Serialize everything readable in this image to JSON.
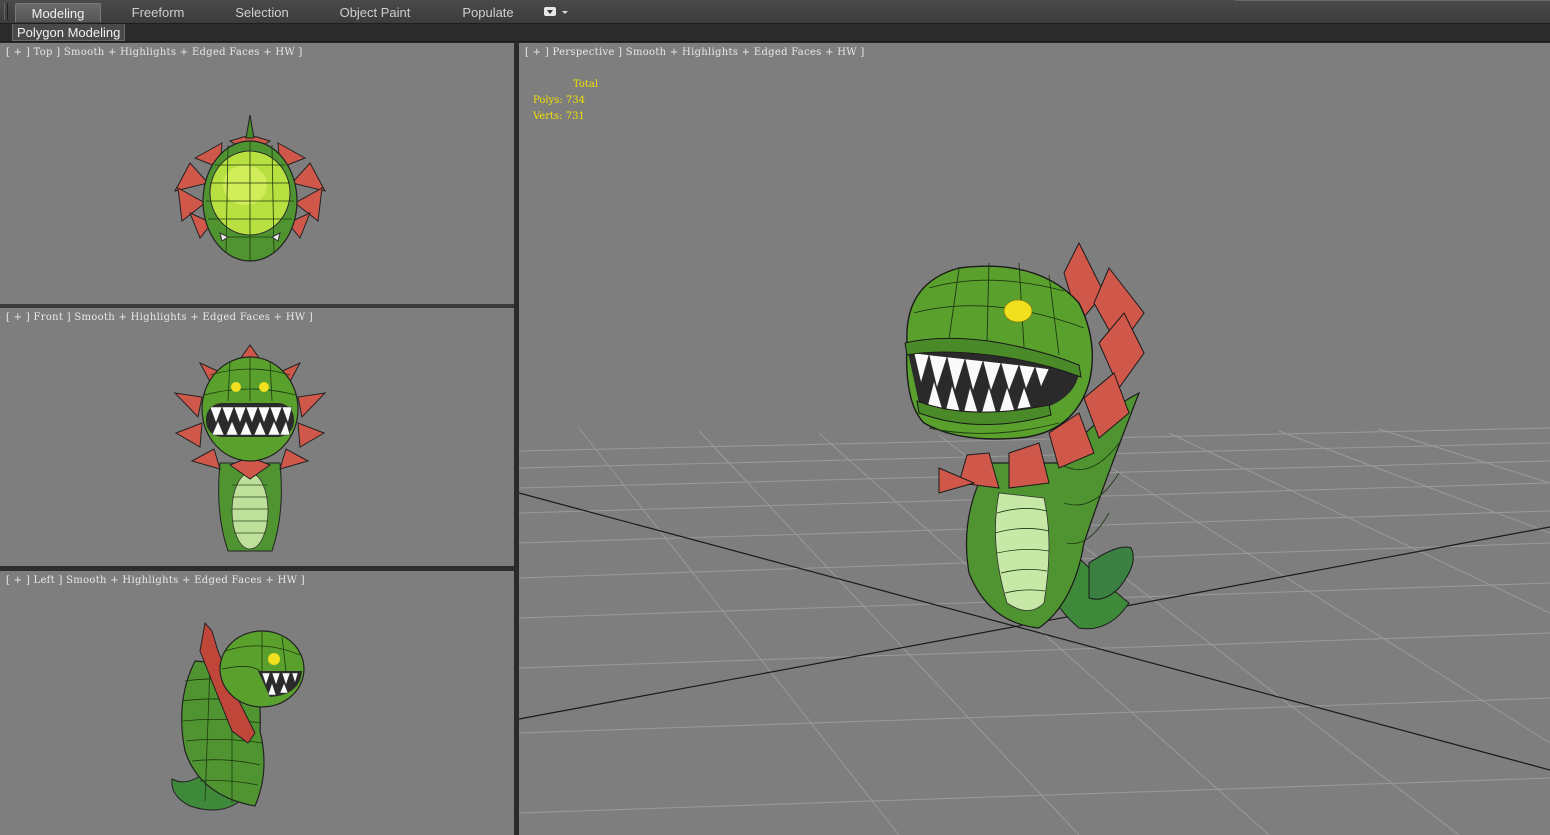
{
  "ribbon": {
    "tabs": [
      {
        "label": "Modeling",
        "active": true
      },
      {
        "label": "Freeform",
        "active": false
      },
      {
        "label": "Selection",
        "active": false
      },
      {
        "label": "Object Paint",
        "active": false
      },
      {
        "label": "Populate",
        "active": false
      }
    ],
    "dropdown_icon": "ribbon-options-dropdown-icon",
    "panel_label": "Polygon Modeling"
  },
  "viewports": {
    "top": {
      "label": "[ + ] Top ] Smooth + Highlights + Edged Faces + HW ]"
    },
    "front": {
      "label": "[ + ] Front ] Smooth + Highlights + Edged Faces + HW ]"
    },
    "left": {
      "label": "[ + ] Left ] Smooth + Highlights + Edged Faces + HW ]"
    },
    "perspective": {
      "label": "[ + ] Perspective ] Smooth + Highlights + Edged Faces + HW ]",
      "stats": {
        "total_label": "Total",
        "polys": "Polys: 734",
        "verts": "Verts: 731"
      }
    }
  },
  "colors": {
    "viewport_bg": "#7e7e7e",
    "stats_text": "#f0e000",
    "model_green": "#5aa02c",
    "petal_red": "#d0584a"
  }
}
